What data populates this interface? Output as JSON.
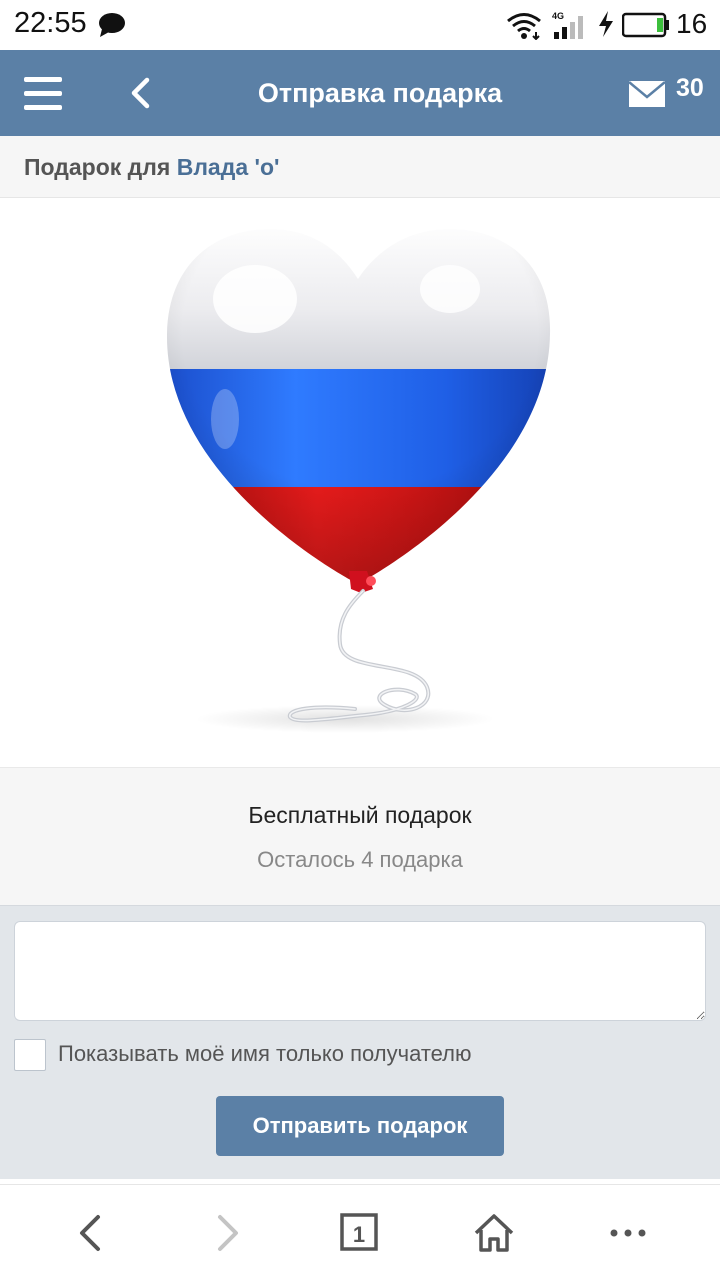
{
  "status_bar": {
    "time": "22:55",
    "battery_level": "16",
    "network": "4G",
    "icons": [
      "chat-icon",
      "wifi-icon",
      "signal-icon",
      "charging-icon",
      "battery-icon"
    ]
  },
  "header": {
    "title": "Отправка подарка",
    "mail_count": "30",
    "background_color": "#5b80a6"
  },
  "recipient": {
    "prefix": "Подарок для",
    "name": "Влада 'о'"
  },
  "gift": {
    "type": "Бесплатный подарок",
    "remaining": "Осталось 4 подарка"
  },
  "form": {
    "message_value": "",
    "checkbox_label": "Показывать моё имя только получателю",
    "checkbox_checked": false,
    "send_label": "Отправить подарок"
  },
  "bottom_nav": {
    "tab_count": "1",
    "icons": [
      "back-icon",
      "forward-icon",
      "tabs-icon",
      "home-icon",
      "more-icon"
    ]
  }
}
